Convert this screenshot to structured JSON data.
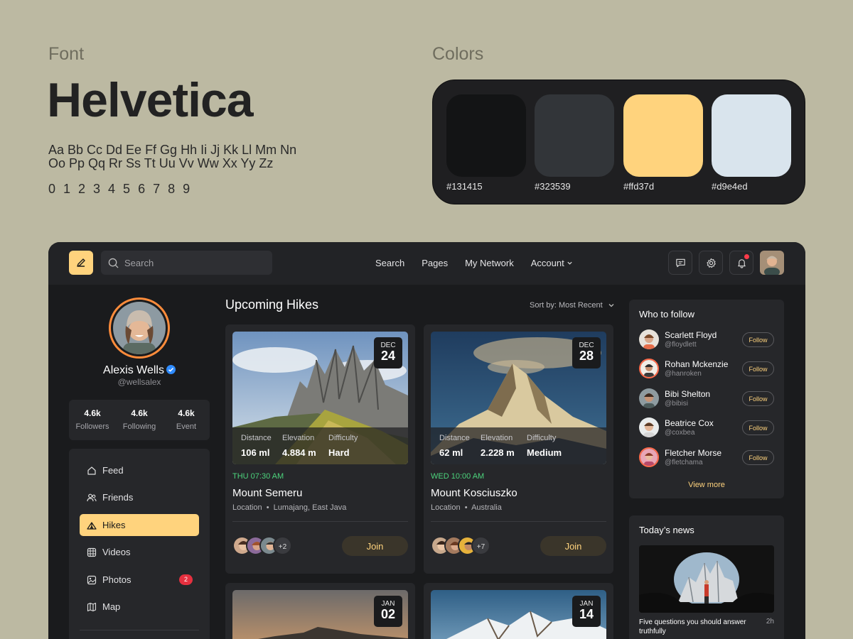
{
  "style_guide": {
    "font_label": "Font",
    "font_name": "Helvetica",
    "alphabet": "Aa Bb Cc Dd Ee Ff Gg Hh Ii Jj Kk Ll Mm Nn Oo Pp Qq Rr Ss Tt Uu Vv Ww Xx Yy Zz",
    "digits": "0 1 2 3 4 5 6 7 8 9",
    "colors_label": "Colors",
    "colors": [
      {
        "hex": "#131415",
        "label": "#131415"
      },
      {
        "hex": "#323539",
        "label": "#323539"
      },
      {
        "hex": "#ffd37d",
        "label": "#ffd37d"
      },
      {
        "hex": "#d9e4ed",
        "label": "#d9e4ed"
      }
    ]
  },
  "topbar": {
    "search_placeholder": "Search",
    "nav": [
      "Search",
      "Pages",
      "My Network",
      "Account"
    ],
    "account_chevron_icon": "chevron-down-icon",
    "icons": [
      "edit-icon",
      "chat-icon",
      "gear-icon",
      "bell-icon"
    ],
    "has_notification": true
  },
  "profile": {
    "name": "Alexis Wells",
    "handle": "@wellsalex",
    "verified": true,
    "stats": [
      {
        "value": "4.6k",
        "label": "Followers"
      },
      {
        "value": "4.6k",
        "label": "Following"
      },
      {
        "value": "4.6k",
        "label": "Event"
      }
    ]
  },
  "menu": [
    {
      "label": "Feed",
      "icon": "home-icon"
    },
    {
      "label": "Friends",
      "icon": "users-icon"
    },
    {
      "label": "Hikes",
      "icon": "tent-icon",
      "active": true
    },
    {
      "label": "Videos",
      "icon": "video-icon"
    },
    {
      "label": "Photos",
      "icon": "image-icon",
      "badge": "2"
    },
    {
      "label": "Map",
      "icon": "map-icon"
    }
  ],
  "main": {
    "title": "Upcoming Hikes",
    "sort_label": "Sort by: Most Recent",
    "cards": [
      {
        "month": "DEC",
        "day": "24",
        "distance_label": "Distance",
        "distance": "106 ml",
        "elevation_label": "Elevation",
        "elevation": "4.884 m",
        "difficulty_label": "Difficulty",
        "difficulty": "Hard",
        "time": "THU 07:30 AM",
        "title": "Mount Semeru",
        "location_label": "Location",
        "location": "Lumajang, East Java",
        "more": "+2",
        "join": "Join"
      },
      {
        "month": "DEC",
        "day": "28",
        "distance_label": "Distance",
        "distance": "62 ml",
        "elevation_label": "Elevation",
        "elevation": "2.228 m",
        "difficulty_label": "Difficulty",
        "difficulty": "Medium",
        "time": "WED 10:00 AM",
        "title": "Mount Kosciuszko",
        "location_label": "Location",
        "location": "Australia",
        "more": "+7",
        "join": "Join"
      },
      {
        "month": "JAN",
        "day": "02"
      },
      {
        "month": "JAN",
        "day": "14"
      }
    ]
  },
  "who_to_follow": {
    "title": "Who to follow",
    "users": [
      {
        "name": "Scarlett Floyd",
        "handle": "@floydlett",
        "button": "Follow"
      },
      {
        "name": "Rohan Mckenzie",
        "handle": "@hanroken",
        "button": "Follow"
      },
      {
        "name": "Bibi Shelton",
        "handle": "@bibisi",
        "button": "Follow"
      },
      {
        "name": "Beatrice Cox",
        "handle": "@coxbea",
        "button": "Follow"
      },
      {
        "name": "Fletcher Morse",
        "handle": "@fletchama",
        "button": "Follow"
      }
    ],
    "view_more": "View more"
  },
  "news": {
    "title": "Today’s news",
    "headline": "Five questions you should answer truthfully",
    "time": "2h"
  }
}
